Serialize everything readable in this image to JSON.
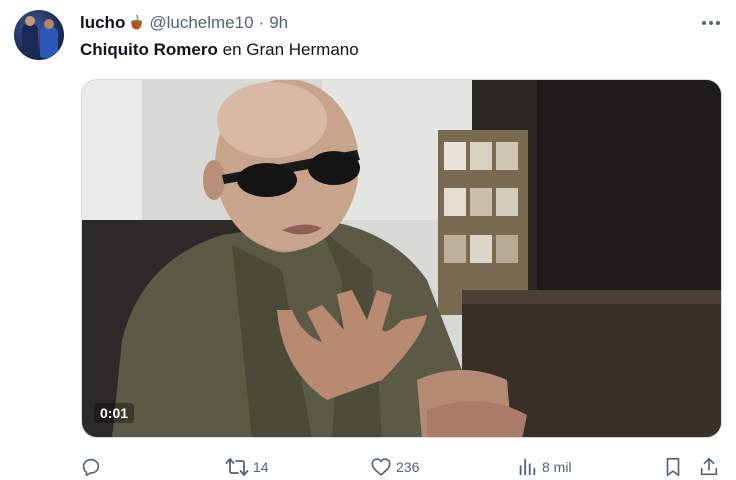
{
  "tweet": {
    "author_name": "lucho",
    "author_handle": "@luchelme10",
    "separator": "·",
    "time": "9h",
    "text_bold": "Chiquito Romero",
    "text_rest": " en Gran Hermano",
    "video": {
      "timestamp": "0:01"
    },
    "actions": {
      "reply": {
        "icon": "reply-icon",
        "count": ""
      },
      "retweet": {
        "icon": "retweet-icon",
        "count": "14"
      },
      "like": {
        "icon": "heart-icon",
        "count": "236"
      },
      "views": {
        "icon": "views-icon",
        "count": "8 mil"
      },
      "bookmark": {
        "icon": "bookmark-icon"
      },
      "share": {
        "icon": "share-icon"
      }
    }
  },
  "colors": {
    "text_primary": "#0f1419",
    "text_secondary": "#536471",
    "border": "#cfd9de"
  }
}
